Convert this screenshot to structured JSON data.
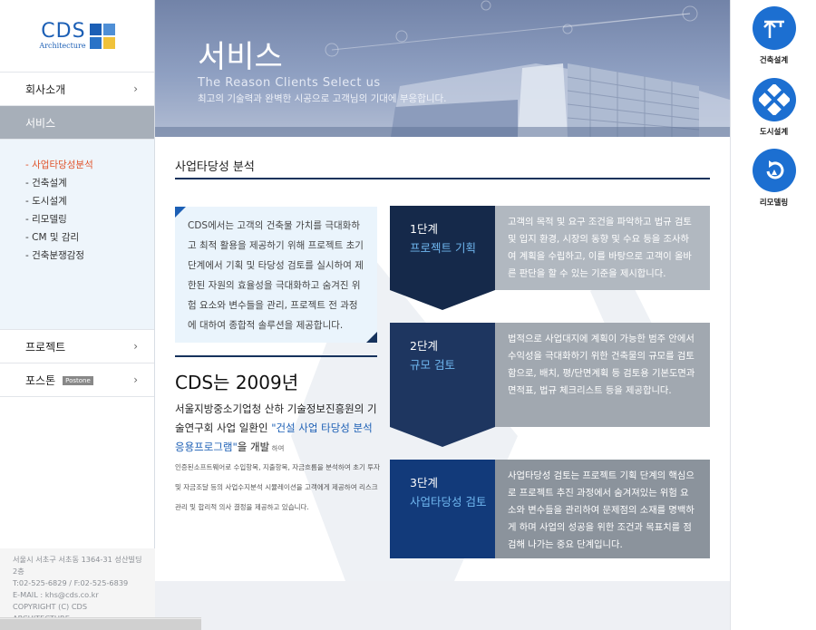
{
  "logo": {
    "brand": "CDS",
    "sub": "Architecture"
  },
  "sidebar": {
    "items": [
      {
        "label": "회사소개"
      },
      {
        "label": "서비스"
      },
      {
        "label": "프로젝트"
      },
      {
        "label": "포스톤",
        "badge": "Postone"
      }
    ],
    "chevron": "›",
    "submenu": [
      "- 사업타당성분석",
      "- 건축설계",
      "- 도시설계",
      "- 리모델링",
      "- CM 및 감리",
      "- 건축분쟁감정"
    ],
    "footer": [
      "서울시 서초구 서초동 1364-31 성산빌딩 2층",
      "T:02-525-6829 / F:02-525-6839",
      "E-MAIL : khs@cds.co.kr",
      "COPYRIGHT (C) CDS ARCHITECTURE"
    ]
  },
  "banner": {
    "title": "서비스",
    "subtitle": "The Reason Clients Select us",
    "desc": "최고의 기술력과 완벽한 시공으로 고객님의 기대에 부응합니다."
  },
  "main": {
    "page_title": "사업타당성 분석",
    "intro": "CDS에서는 고객의 건축물 가치를 극대화하고 최적 활용을 제공하기 위해 프로젝트 초기단계에서 기획 및 타당성 검토를 실시하여 제한된 자원의 효율성을 극대화하고 숨겨진 위험 요소와 변수들을 관리, 프로젝트 전 과정에 대하여 종합적 솔루션을 제공합니다.",
    "since_title": "CDS는 2009년",
    "since_line1": "서울지방중소기업청 산하 기술정보진흥원의 기술연구회 사업 일환인 ",
    "since_highlight": "\"건설 사업 타당성 분석 응용프로그램\"",
    "since_line2": "을 개발",
    "since_small": " 하여",
    "since_detail": "인증된소프트웨어로 수입항목, 지출항목, 자금흐름을 분석하여 초기 투자 및 자금조달 등의 사업수지분석 시뮬레이션을 고객에게 제공하여 리스크 관리 및 합리적 의사 결정을 제공하고 있습니다.",
    "steps": [
      {
        "num": "1단계",
        "name": "프로젝트 기획",
        "text": "고객의 목적 및 요구 조건을 파악하고 법규 검토 및 입지 환경, 시장의 동향 및 수요 등을 조사하여 계획을 수립하고, 이를 바탕으로 고객이 올바른 판단을 할 수 있는 기준을 제시합니다."
      },
      {
        "num": "2단계",
        "name": "규모 검토",
        "text": "법적으로 사업대지에 계획이 가능한 범주 안에서 수익성을 극대화하기 위한 건축물의 규모를 검토함으로, 배치, 평/단면계획 등 검토용 기본도면과 면적표, 법규 체크리스트 등을 제공합니다."
      },
      {
        "num": "3단계",
        "name": "사업타당성 검토",
        "text": "사업타당성 검토는 프로젝트 기획 단계의 핵심으로 프로젝트 추진 과정에서 숨겨져있는 위험 요소와 변수들을 관리하여 문제점의 소재를 명백하게 하며 사업의 성공을 위한 조건과 목표치를 점검해 나가는 중요 단계입니다."
      }
    ]
  },
  "quick": [
    {
      "label": "건축설계",
      "icon": "crane-icon"
    },
    {
      "label": "도시설계",
      "icon": "city-map-icon"
    },
    {
      "label": "리모델링",
      "icon": "remodel-icon"
    }
  ],
  "colors": {
    "accent": "#1c6fd1",
    "navy": "#16325c",
    "highlight": "#e0542b"
  }
}
